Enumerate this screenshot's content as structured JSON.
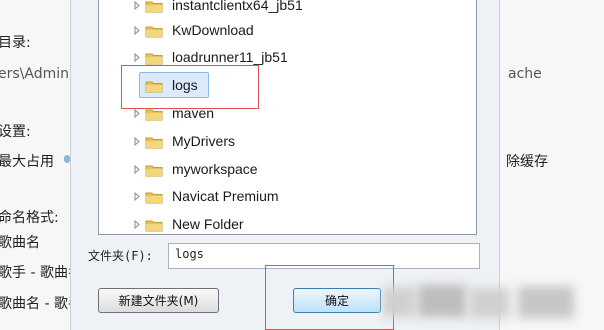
{
  "background": {
    "labels": [
      {
        "text": "目录:"
      },
      {
        "text": "ers\\Admini"
      },
      {
        "text": "ache"
      },
      {
        "text": "设置:"
      },
      {
        "text": "最大占用"
      },
      {
        "text": "除缓存"
      },
      {
        "text": "命名格式:"
      },
      {
        "text": "歌曲名"
      },
      {
        "text": "歌手 - 歌曲名"
      },
      {
        "text": "歌曲名 - 歌手"
      }
    ]
  },
  "dialog": {
    "tree": {
      "items": [
        {
          "label": "instantclientx64_jb51"
        },
        {
          "label": "KwDownload"
        },
        {
          "label": "loadrunner11_jb51"
        },
        {
          "label": "logs",
          "selected": true
        },
        {
          "label": "maven"
        },
        {
          "label": "MyDrivers"
        },
        {
          "label": "myworkspace"
        },
        {
          "label": "Navicat Premium"
        },
        {
          "label": "New Folder"
        }
      ]
    },
    "folder_field": {
      "label": "文件夹(F):",
      "value": "logs"
    },
    "buttons": {
      "new_folder": "新建文件夹(M)",
      "ok": "确定"
    }
  },
  "colors": {
    "highlight_red": "#d9534f",
    "folder_yellow": "#e8c15a"
  }
}
